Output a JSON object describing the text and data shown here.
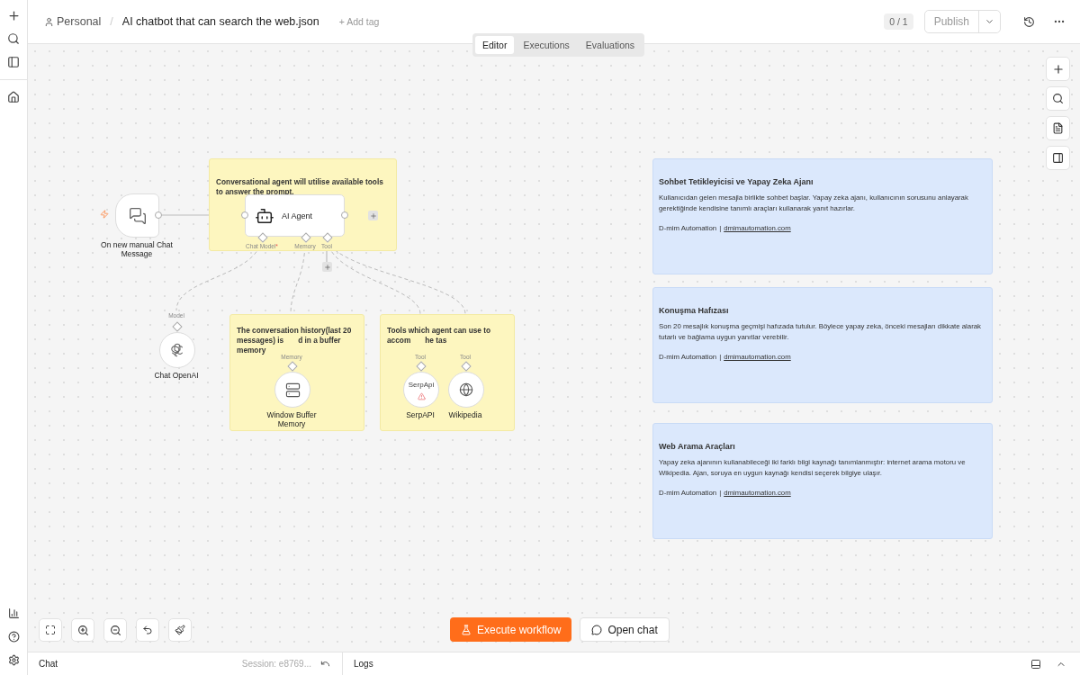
{
  "header": {
    "project": "Personal",
    "separator": "/",
    "title": "AI chatbot that can search the web.json",
    "add_tag": "+ Add tag",
    "version": "0 / 1",
    "publish": "Publish"
  },
  "tabs": [
    {
      "label": "Editor",
      "selected": true
    },
    {
      "label": "Executions",
      "selected": false
    },
    {
      "label": "Evaluations",
      "selected": false
    }
  ],
  "sticky_notes": [
    {
      "lines": [
        [
          "Conversational agent will utilise available tools to answer the prompt."
        ]
      ]
    },
    {
      "lines": [
        [
          "The conversation history(last 20"
        ],
        [
          "messages) is",
          "d in a buffer"
        ],
        [
          "memory"
        ]
      ]
    },
    {
      "lines": [
        [
          "Tools which agent can use to"
        ],
        [
          "accom",
          "he tas"
        ]
      ]
    }
  ],
  "nodes": [
    {
      "kind": "trigger",
      "label": "On new manual Chat Message"
    },
    {
      "kind": "agent",
      "label": "AI Agent",
      "handles": [
        {
          "label": "Chat Model",
          "required_mark": "*"
        },
        {
          "label": "Memory"
        },
        {
          "label": "Tool"
        }
      ]
    },
    {
      "kind": "model",
      "label": "Chat OpenAI",
      "input": "Model"
    },
    {
      "kind": "memory",
      "label": "Window Buffer Memory",
      "input": "Memory"
    },
    {
      "kind": "serpapi",
      "label": "SerpAPI",
      "input": "Tool",
      "logo_text": "SerpApi",
      "warning": true
    },
    {
      "kind": "wikipedia",
      "label": "Wikipedia",
      "input": "Tool"
    }
  ],
  "info_notes": [
    {
      "title": "Sohbet Tetikleyicisi ve Yapay Zeka Ajanı",
      "body": "Kullanıcıdan gelen mesajla birlikte sohbet başlar. Yapay zeka ajanı, kullanıcının sorusunu anlayarak gerektiğinde kendisine tanımlı araçları kullanarak yanıt hazırlar.",
      "author": "D-mim Automation",
      "separator": "|",
      "link": "dmimautomation.com"
    },
    {
      "title": "Konuşma Hafızası",
      "body": "Son 20 mesajlık konuşma geçmişi hafızada tutulur. Böylece yapay zeka, önceki mesajları dikkate alarak tutarlı ve bağlama uygun yanıtlar verebilir.",
      "author": "D-mim Automation",
      "separator": "|",
      "link": "dmimautomation.com"
    },
    {
      "title": "Web Arama Araçları",
      "body": "Yapay zeka ajanının kullanabileceği iki farklı bilgi kaynağı tanımlanmıştır: internet arama motoru ve Wikipedia. Ajan, soruya en uygun kaynağı kendisi seçerek bilgiye ulaşır.",
      "author": "D-mim Automation",
      "separator": "|",
      "link": "dmimautomation.com"
    }
  ],
  "actions": {
    "execute": "Execute workflow",
    "open_chat": "Open chat"
  },
  "bottom_panel": {
    "chat": "Chat",
    "session": "Session: e8769...",
    "logs": "Logs"
  }
}
